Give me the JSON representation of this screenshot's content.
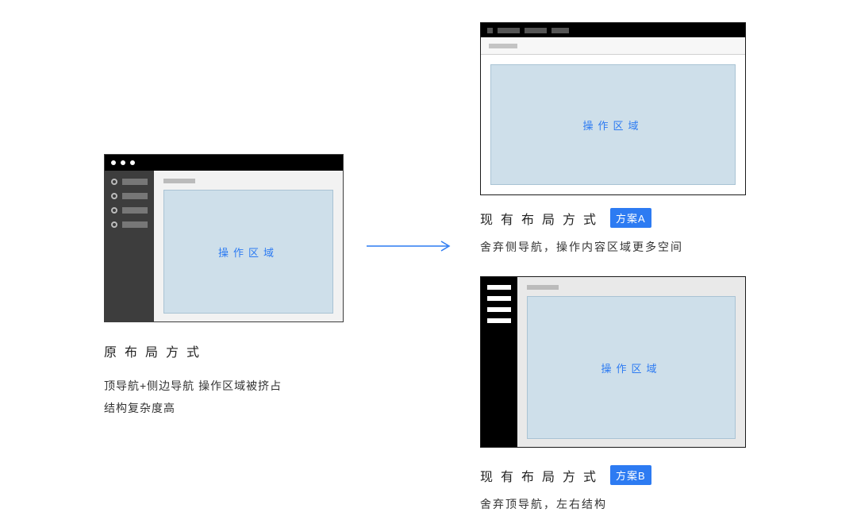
{
  "content_area_label": "操作区域",
  "original": {
    "title": "原布局方式",
    "desc_line1": "顶导航+侧边导航 操作区域被挤占",
    "desc_line2": "结构复杂度高"
  },
  "variant_a": {
    "title": "现有布局方式",
    "badge": "方案A",
    "desc": "舍弃侧导航，操作内容区域更多空间"
  },
  "variant_b": {
    "title": "现有布局方式",
    "badge": "方案B",
    "desc": "舍弃顶导航，左右结构"
  }
}
